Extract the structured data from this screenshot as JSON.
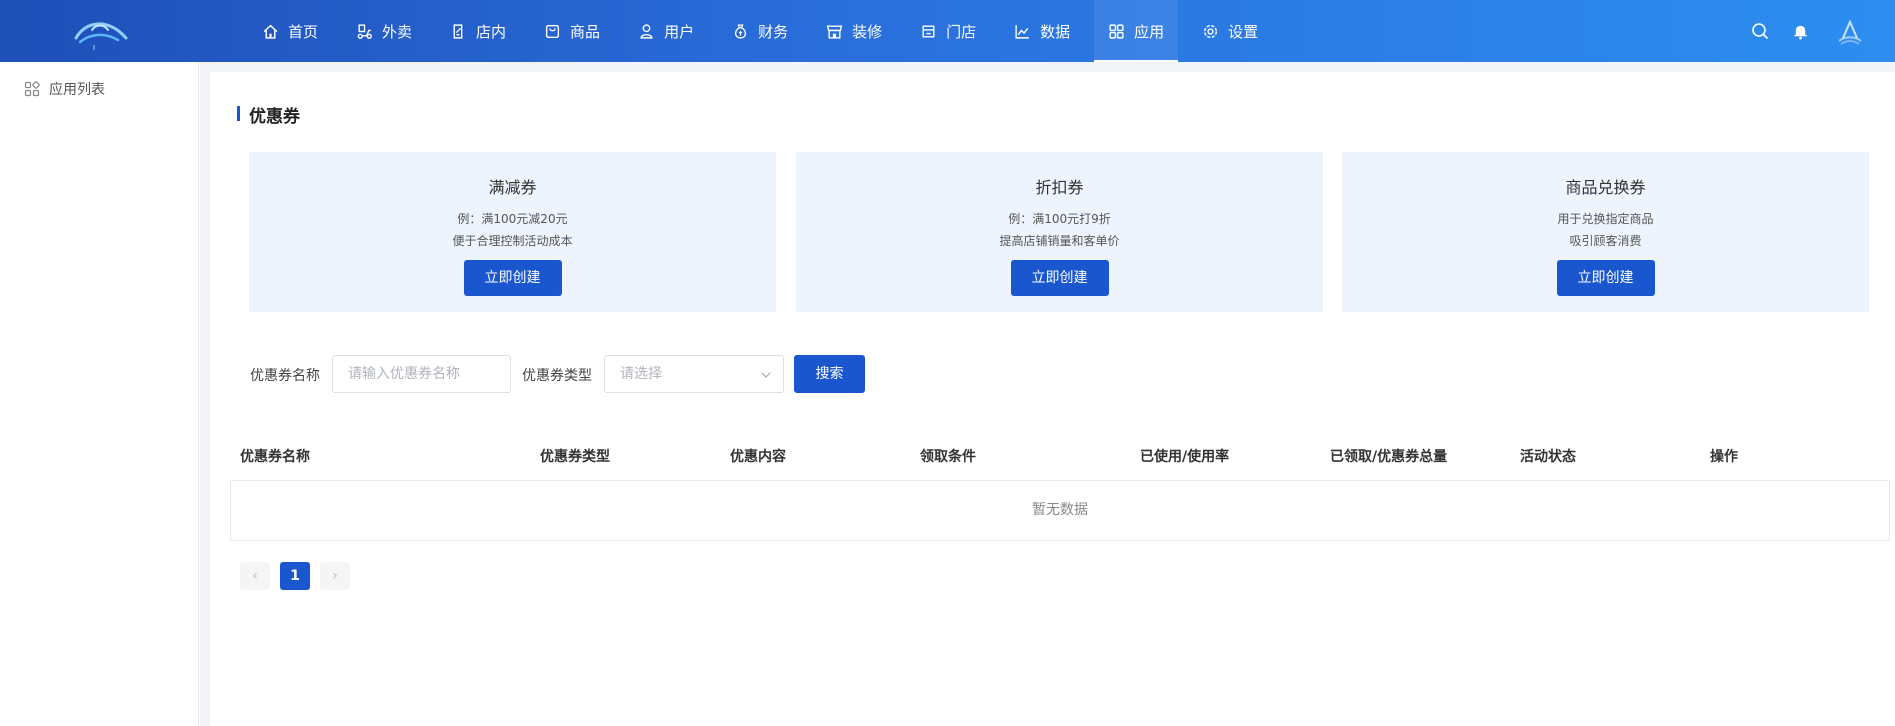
{
  "nav": {
    "items": [
      {
        "label": "首页",
        "icon": "home-icon"
      },
      {
        "label": "外卖",
        "icon": "scooter-icon"
      },
      {
        "label": "店内",
        "icon": "edit-doc-icon"
      },
      {
        "label": "商品",
        "icon": "bag-icon"
      },
      {
        "label": "用户",
        "icon": "user-icon"
      },
      {
        "label": "财务",
        "icon": "money-bag-icon"
      },
      {
        "label": "装修",
        "icon": "shop-front-icon"
      },
      {
        "label": "门店",
        "icon": "store-icon"
      },
      {
        "label": "数据",
        "icon": "chart-line-icon"
      },
      {
        "label": "应用",
        "icon": "apps-grid-icon"
      },
      {
        "label": "设置",
        "icon": "gear-icon"
      }
    ],
    "active": "应用"
  },
  "sidebar": {
    "items": [
      {
        "label": "应用列表",
        "icon": "apps-grid-icon"
      }
    ]
  },
  "page": {
    "title": "优惠券"
  },
  "cards": [
    {
      "title": "满减券",
      "line1": "例：满100元减20元",
      "line2": "便于合理控制活动成本",
      "button": "立即创建"
    },
    {
      "title": "折扣券",
      "line1": "例：满100元打9折",
      "line2": "提高店铺销量和客单价",
      "button": "立即创建"
    },
    {
      "title": "商品兑换券",
      "line1": "用于兑换指定商品",
      "line2": "吸引顾客消费",
      "button": "立即创建"
    }
  ],
  "filters": {
    "name_label": "优惠券名称",
    "name_placeholder": "请输入优惠券名称",
    "type_label": "优惠券类型",
    "type_placeholder": "请选择",
    "search_button": "搜索"
  },
  "table": {
    "columns": [
      "优惠券名称",
      "优惠券类型",
      "优惠内容",
      "领取条件",
      "已使用/使用率",
      "已领取/优惠券总量",
      "活动状态",
      "操作"
    ],
    "empty_text": "暂无数据"
  },
  "pagination": {
    "current": "1",
    "prev": "‹",
    "next": "›"
  },
  "colors": {
    "primary": "#1a57cf",
    "header_gradient_start": "#1f4fb8",
    "header_gradient_end": "#2d8ef0",
    "card_bg": "#eef4fd"
  }
}
